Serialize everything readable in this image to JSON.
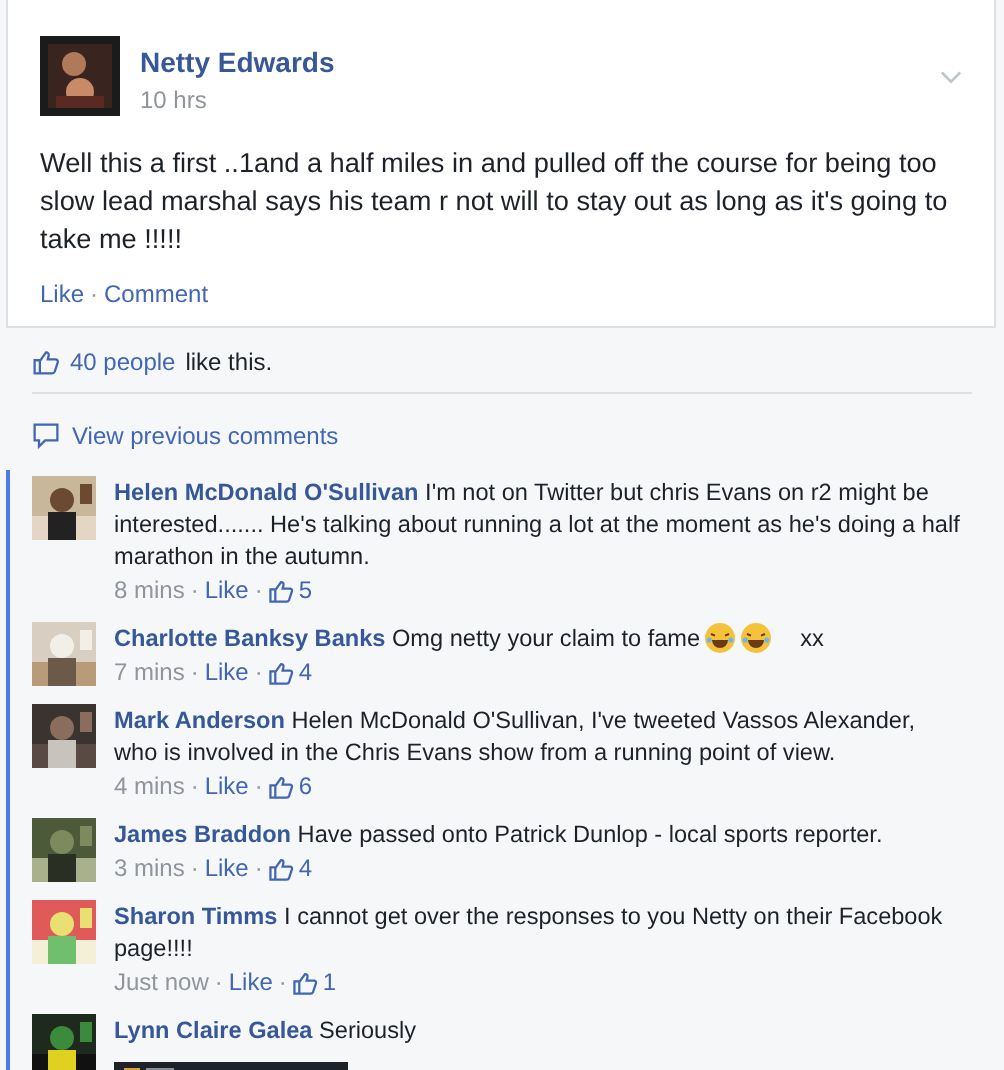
{
  "post": {
    "author": "Netty Edwards",
    "time": "10 hrs",
    "text": "Well this a first ..1and a half miles in and pulled off the course for being too slow lead marshal says his team r not will to stay out as long as it's going to take me !!!!!",
    "actions": [
      "Like",
      "Comment"
    ]
  },
  "separator": "·",
  "likes": {
    "count": "40 people",
    "rest": "like this."
  },
  "view_previous": "View previous comments",
  "comments": [
    {
      "author": "Helen McDonald O'Sullivan",
      "text": "I'm not on Twitter but chris Evans on r2 might be interested....... He's talking about running a lot at the moment as he's doing a half marathon in the autumn.",
      "time": "8 mins",
      "like": "Like",
      "likes": "5"
    },
    {
      "author": "Charlotte Banksy Banks",
      "text": "Omg netty your claim to fame",
      "icons": [
        {
          "kind": "laughing"
        },
        {
          "kind": "laughing"
        }
      ],
      "suffix": "xx",
      "time": "7 mins",
      "like": "Like",
      "likes": "4"
    },
    {
      "author": "Mark Anderson",
      "text": "Helen McDonald O'Sullivan, I've tweeted Vassos Alexander, who is involved in the Chris Evans show from a running point of view.",
      "time": "4 mins",
      "like": "Like",
      "likes": "6"
    },
    {
      "author": "James Braddon",
      "text": "Have passed onto Patrick Dunlop - local sports reporter.",
      "time": "3 mins",
      "like": "Like",
      "likes": "4"
    },
    {
      "author": "Sharon Timms",
      "text": "I cannot get over the responses to you Netty on their Facebook page!!!!",
      "time": "Just now",
      "like": "Like",
      "likes": "1"
    },
    {
      "author": "Lynn Claire Galea",
      "text": "Seriously"
    }
  ]
}
